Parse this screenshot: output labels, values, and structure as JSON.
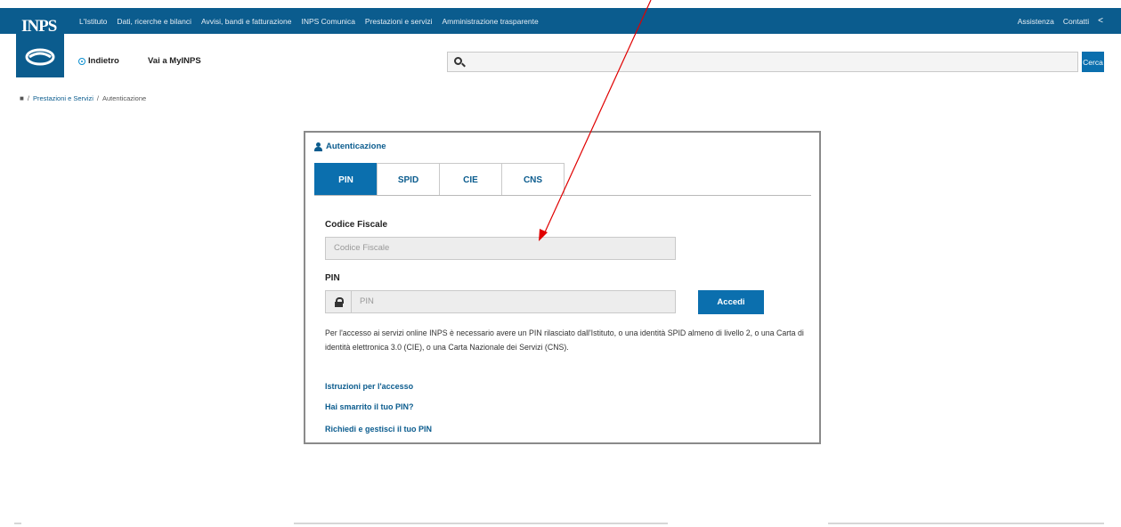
{
  "brand": {
    "logo": "INPS"
  },
  "topnav": {
    "items": [
      "L'Istituto",
      "Dati, ricerche e bilanci",
      "Avvisi, bandi e fatturazione",
      "INPS Comunica",
      "Prestazioni e servizi",
      "Amministrazione trasparente"
    ],
    "right": [
      "Assistenza",
      "Contatti"
    ],
    "share_icon": "share-icon"
  },
  "subnav": {
    "back_label": "Indietro",
    "myinps_label": "Vai a MyINPS"
  },
  "search": {
    "placeholder": "",
    "button_label": "Cerca"
  },
  "breadcrumb": {
    "home_icon": "home-icon",
    "items": [
      "Prestazioni e Servizi",
      "Autenticazione"
    ]
  },
  "panel": {
    "title": "Autenticazione",
    "tabs": [
      "PIN",
      "SPID",
      "CIE",
      "CNS"
    ],
    "active_tab": "PIN",
    "codice_fiscale": {
      "label": "Codice Fiscale",
      "placeholder": "Codice Fiscale"
    },
    "pin": {
      "label": "PIN",
      "placeholder": "PIN"
    },
    "submit_label": "Accedi",
    "info_text": "Per l'accesso ai servizi online INPS è necessario avere un PIN rilasciato dall'Istituto, o una identità SPID almeno di livello 2, o una Carta di identità elettronica 3.0 (CIE), o una Carta Nazionale dei Servizi (CNS).",
    "links": [
      "Istruzioni per l'accesso",
      "Hai smarrito il tuo PIN?",
      "Richiedi e gestisci il tuo PIN"
    ]
  },
  "colors": {
    "brand_blue": "#0b5c8e",
    "button_blue": "#0b6fae",
    "annotation_arrow": "#e00000"
  }
}
